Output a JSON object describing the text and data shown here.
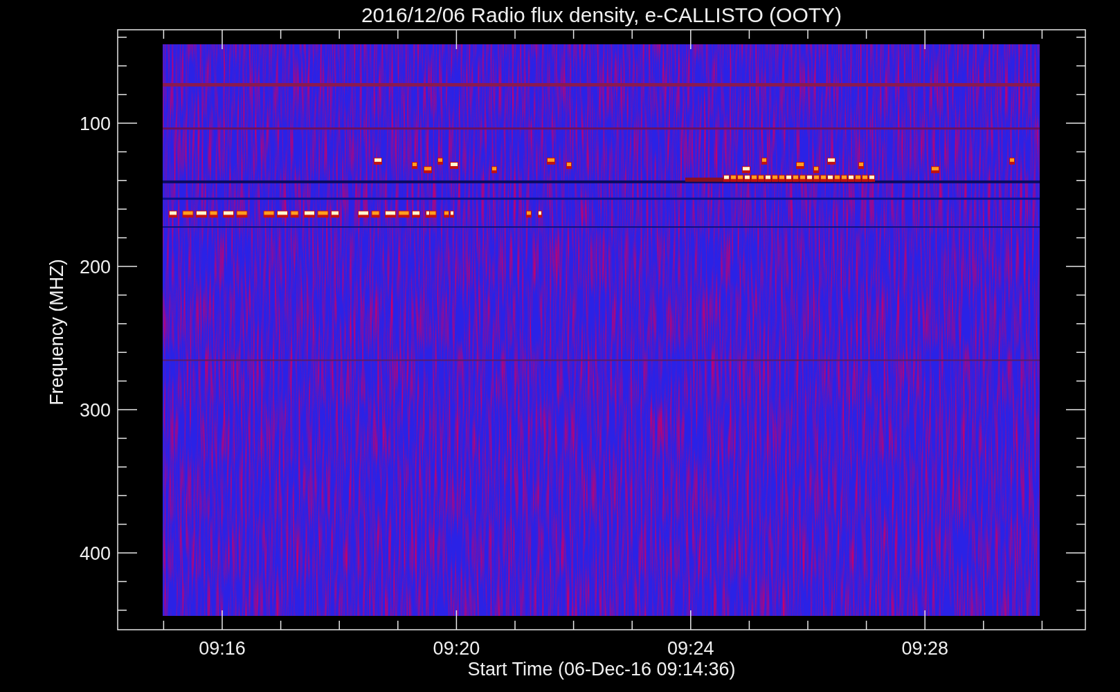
{
  "title": "2016/12/06  Radio flux density, e-CALLISTO (OOTY)",
  "y_axis": {
    "label": "Frequency (MHZ)",
    "ticks": [
      "100",
      "200",
      "300",
      "400"
    ]
  },
  "x_axis": {
    "label": "Start Time (06-Dec-16 09:14:36)",
    "ticks": [
      "09:16",
      "09:20",
      "09:24",
      "09:28"
    ]
  }
}
